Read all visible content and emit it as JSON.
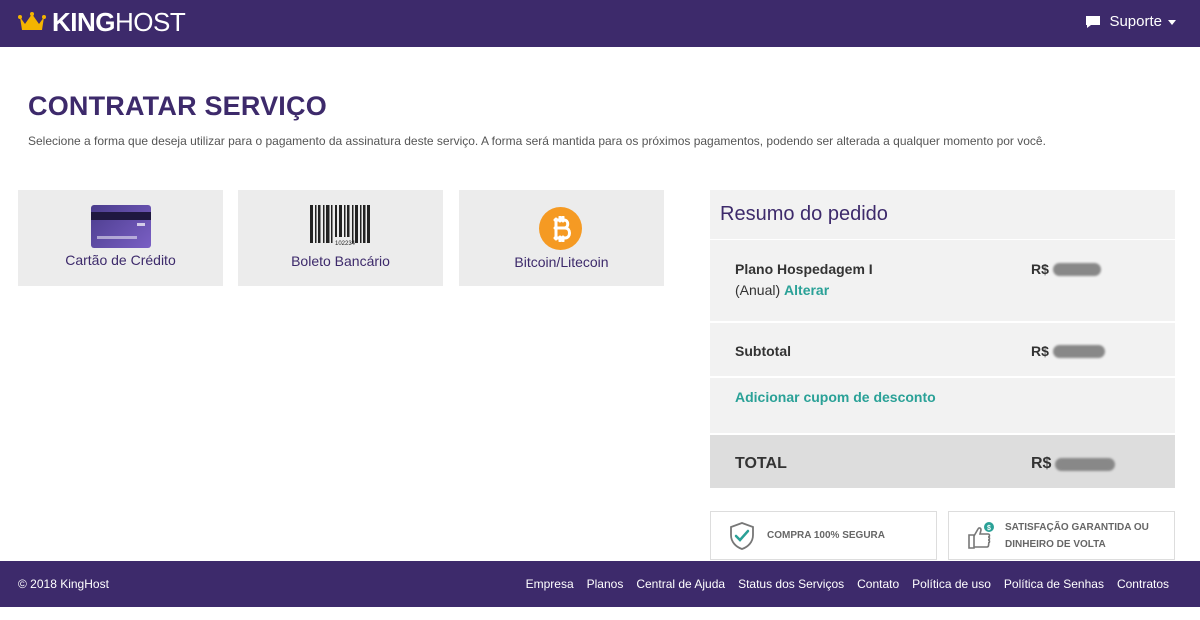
{
  "header": {
    "brand_bold": "KING",
    "brand_light": "HOST",
    "support_label": "Suporte"
  },
  "page": {
    "title": "CONTRATAR SERVIÇO",
    "description": "Selecione a forma que deseja utilizar para o pagamento da assinatura deste serviço. A forma será mantida para os próximos pagamentos, podendo ser alterada a qualquer momento por você."
  },
  "payment_options": [
    {
      "label": "Cartão de Crédito",
      "icon": "credit-card-icon"
    },
    {
      "label": "Boleto Bancário",
      "icon": "barcode-icon",
      "barcode_number": "102234"
    },
    {
      "label": "Bitcoin/Litecoin",
      "icon": "bitcoin-icon"
    }
  ],
  "summary": {
    "title": "Resumo do pedido",
    "plan_name": "Plano Hospedagem I",
    "plan_period": "(Anual)",
    "change_link": "Alterar",
    "currency": "R$",
    "subtotal_label": "Subtotal",
    "coupon_link": "Adicionar cupom de desconto",
    "total_label": "TOTAL"
  },
  "badges": {
    "secure": "COMPRA 100% SEGURA",
    "satisfaction_line1": "SATISFAÇÃO GARANTIDA OU",
    "satisfaction_line2": "DINHEIRO DE VOLTA"
  },
  "footer": {
    "copyright": "© 2018 KingHost",
    "links": [
      "Empresa",
      "Planos",
      "Central de Ajuda",
      "Status dos Serviços",
      "Contato",
      "Política de uso",
      "Política de Senhas",
      "Contratos"
    ]
  },
  "colors": {
    "brand_purple": "#3d2a6b",
    "accent_teal": "#2aa197",
    "bitcoin_orange": "#f59a23",
    "crown_gold": "#f4b400"
  }
}
